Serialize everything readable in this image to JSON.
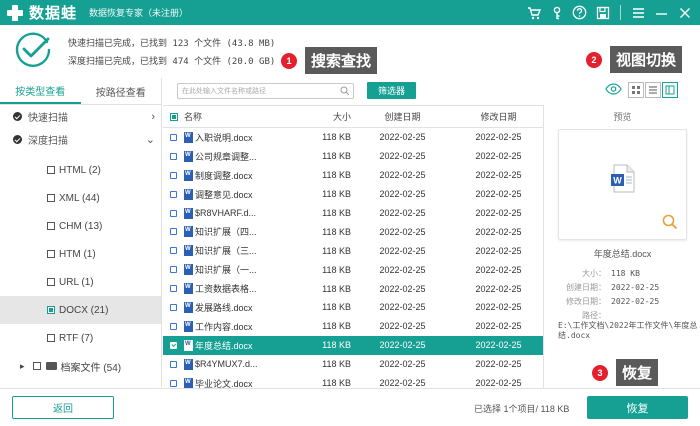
{
  "app": {
    "name": "数据蛙",
    "subtitle": "数据恢复专家（未注册）"
  },
  "summary": {
    "quick_scan": "快速扫描已完成，已找到 123 个文件 (43.8 MB)",
    "deep_scan": "深度扫描已完成，已找到 474 个文件 (20.0 GB)"
  },
  "callouts": [
    {
      "num": "1",
      "label": "搜索查找"
    },
    {
      "num": "2",
      "label": "视图切换"
    },
    {
      "num": "3",
      "label": "恢复"
    }
  ],
  "sidebar": {
    "tabs": [
      "按类型查看",
      "按路径查看"
    ],
    "scans": [
      "快速扫描",
      "深度扫描"
    ],
    "file_types": [
      "HTML (2)",
      "XML (44)",
      "CHM (13)",
      "HTM (1)",
      "URL (1)",
      "DOCX (21)",
      "RTF (7)"
    ],
    "archive": "档案文件 (54)"
  },
  "toolbar": {
    "search_placeholder": "在此处输入文件名称或路径",
    "filter_label": "筛选器"
  },
  "table": {
    "headers": [
      "名称",
      "大小",
      "创建日期",
      "修改日期"
    ],
    "rows": [
      {
        "name": "入职说明.docx",
        "size": "118 KB",
        "created": "2022-02-25",
        "modified": "2022-02-25"
      },
      {
        "name": "公司规章调整...",
        "size": "118 KB",
        "created": "2022-02-25",
        "modified": "2022-02-25"
      },
      {
        "name": "制度调整.docx",
        "size": "118 KB",
        "created": "2022-02-25",
        "modified": "2022-02-25"
      },
      {
        "name": "调整意见.docx",
        "size": "118 KB",
        "created": "2022-02-25",
        "modified": "2022-02-25"
      },
      {
        "name": "$R8VHARF.d...",
        "size": "118 KB",
        "created": "2022-02-25",
        "modified": "2022-02-25"
      },
      {
        "name": "知识扩展（四...",
        "size": "118 KB",
        "created": "2022-02-25",
        "modified": "2022-02-25"
      },
      {
        "name": "知识扩展（三...",
        "size": "118 KB",
        "created": "2022-02-25",
        "modified": "2022-02-25"
      },
      {
        "name": "知识扩展（一...",
        "size": "118 KB",
        "created": "2022-02-25",
        "modified": "2022-02-25"
      },
      {
        "name": "工资数据表格...",
        "size": "118 KB",
        "created": "2022-02-25",
        "modified": "2022-02-25"
      },
      {
        "name": "发展路线.docx",
        "size": "118 KB",
        "created": "2022-02-25",
        "modified": "2022-02-25"
      },
      {
        "name": "工作内容.docx",
        "size": "118 KB",
        "created": "2022-02-25",
        "modified": "2022-02-25"
      },
      {
        "name": "年度总结.docx",
        "size": "118 KB",
        "created": "2022-02-25",
        "modified": "2022-02-25",
        "selected": true
      },
      {
        "name": "$R4YMUX7.d...",
        "size": "118 KB",
        "created": "2022-02-25",
        "modified": "2022-02-25"
      },
      {
        "name": "毕业论文.docx",
        "size": "118 KB",
        "created": "2022-02-25",
        "modified": "2022-02-25"
      }
    ]
  },
  "preview": {
    "title": "预览",
    "file_name": "年度总结.docx",
    "size_label": "大小：",
    "size_value": "118 KB",
    "created_label": "创建日期：",
    "created_value": "2022-02-25",
    "modified_label": "修改日期：",
    "modified_value": "2022-02-25",
    "path_label": "路径：",
    "path_value": "E:\\工作文档\\2022年工作文件\\年度总结.docx"
  },
  "bottom": {
    "back_label": "返回",
    "status": "已选择 1个项目/ 118 KB",
    "recover_label": "恢复"
  },
  "colors": {
    "accent": "#16a093",
    "callout_red": "#e5202e"
  }
}
